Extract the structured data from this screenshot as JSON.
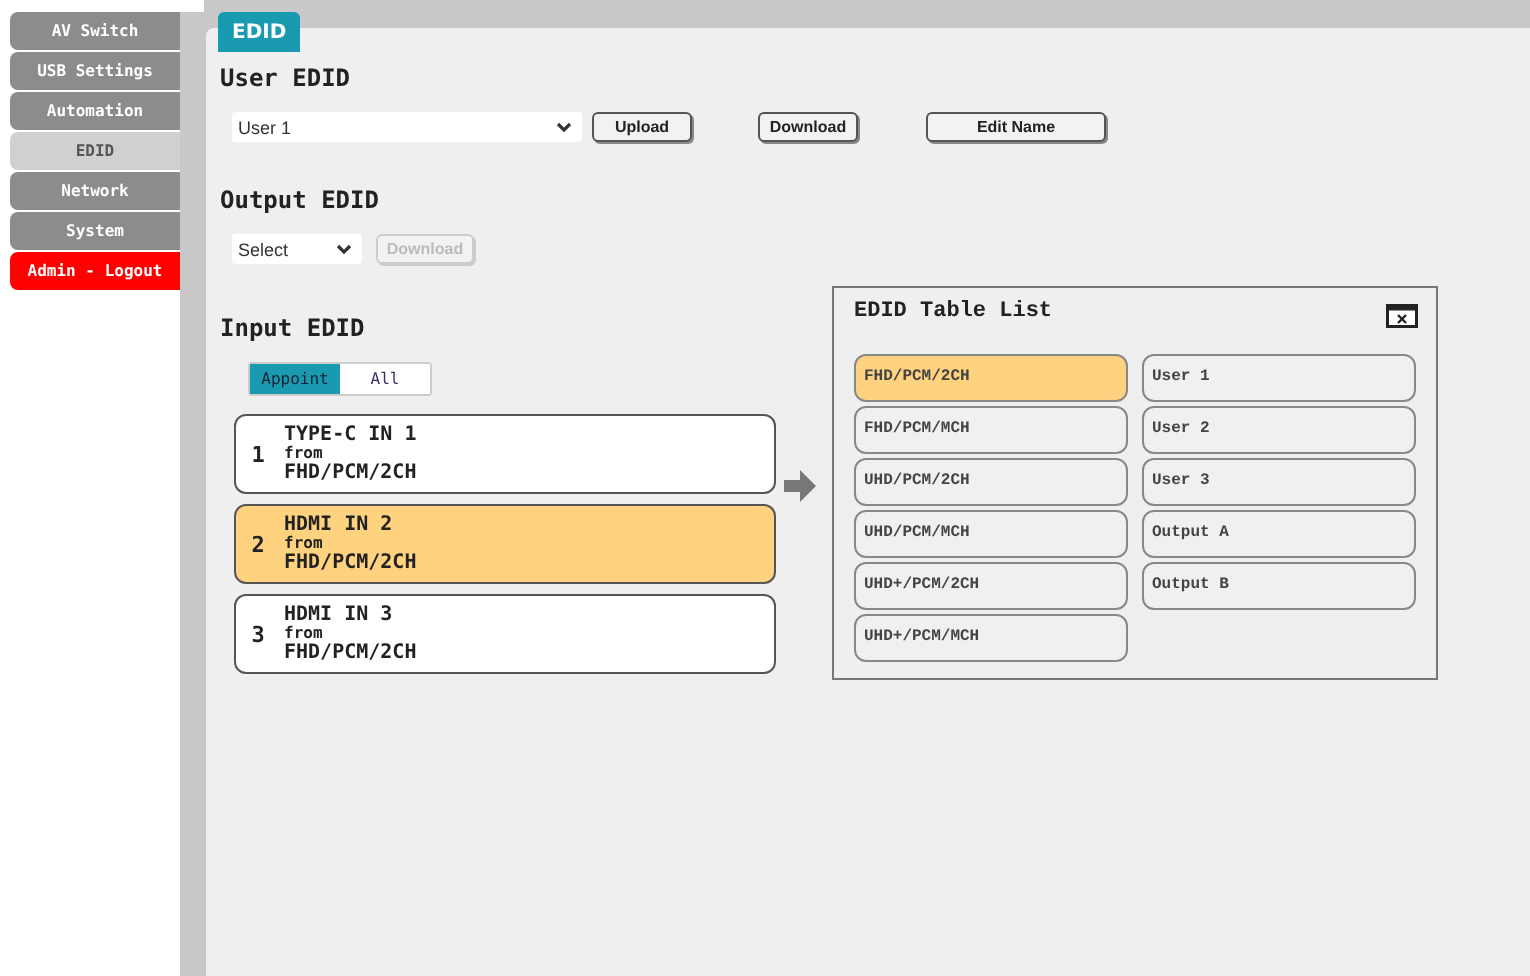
{
  "sidebar": {
    "items": [
      {
        "label": "AV Switch",
        "kind": "page",
        "selected": false
      },
      {
        "label": "USB Settings",
        "kind": "page",
        "selected": false
      },
      {
        "label": "Automation",
        "kind": "page",
        "selected": false
      },
      {
        "label": "EDID",
        "kind": "page",
        "selected": true
      },
      {
        "label": "Network",
        "kind": "page",
        "selected": false
      },
      {
        "label": "System",
        "kind": "page",
        "selected": false
      },
      {
        "label": "Admin - Logout",
        "kind": "logout",
        "selected": false
      }
    ]
  },
  "panel_tab": "EDID",
  "user_edid": {
    "heading": "User EDID",
    "select_value": "User 1",
    "buttons": [
      {
        "label": "Upload",
        "disabled": false
      },
      {
        "label": "Download",
        "disabled": false
      },
      {
        "label": "Edit Name",
        "disabled": false
      }
    ]
  },
  "output_edid": {
    "heading": "Output EDID",
    "select_value": "Select",
    "buttons": [
      {
        "label": "Download",
        "disabled": true
      }
    ]
  },
  "input_edid": {
    "heading": "Input EDID",
    "modes": [
      {
        "label": "Appoint",
        "selected": true
      },
      {
        "label": "All",
        "selected": false
      }
    ],
    "inputs": [
      {
        "number": "1",
        "name": "TYPE-C IN 1",
        "from": "from",
        "edid": "FHD/PCM/2CH",
        "selected": false
      },
      {
        "number": "2",
        "name": "HDMI IN 2",
        "from": "from",
        "edid": "FHD/PCM/2CH",
        "selected": true
      },
      {
        "number": "3",
        "name": "HDMI IN 3",
        "from": "from",
        "edid": "FHD/PCM/2CH",
        "selected": false
      }
    ]
  },
  "edid_table": {
    "title": "EDID Table List",
    "columns": [
      [
        {
          "label": "FHD/PCM/2CH",
          "selected": true
        },
        {
          "label": "FHD/PCM/MCH",
          "selected": false
        },
        {
          "label": "UHD/PCM/2CH",
          "selected": false
        },
        {
          "label": "UHD/PCM/MCH",
          "selected": false
        },
        {
          "label": "UHD+/PCM/2CH",
          "selected": false
        },
        {
          "label": "UHD+/PCM/MCH",
          "selected": false
        }
      ],
      [
        {
          "label": "User 1",
          "selected": false
        },
        {
          "label": "User 2",
          "selected": false
        },
        {
          "label": "User 3",
          "selected": false
        },
        {
          "label": "Output A",
          "selected": false
        },
        {
          "label": "Output B",
          "selected": false
        }
      ]
    ]
  }
}
